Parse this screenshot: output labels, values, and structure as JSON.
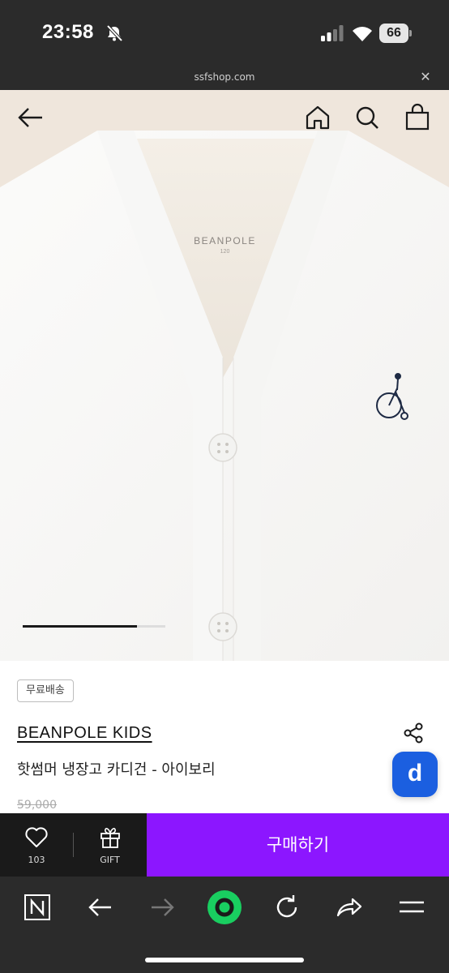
{
  "status_bar": {
    "time": "23:58",
    "battery": "66"
  },
  "url_bar": {
    "domain": "ssfshop.com",
    "close_icon": "close-icon"
  },
  "image_nav": {
    "back_icon": "arrow-left-icon",
    "home_icon": "home-icon",
    "search_icon": "search-icon",
    "cart_icon": "shopping-bag-icon"
  },
  "product_photo": {
    "tag_brand": "BEANPOLE",
    "tag_size": "120"
  },
  "carousel": {
    "progress": 0.8
  },
  "product": {
    "badge": "무료배송",
    "brand": "BEANPOLE KIDS",
    "name": "핫썸머 냉장고 카디건 - 아이보리",
    "price": "59,000",
    "floating_button_label": "d"
  },
  "purchase_bar": {
    "like_count": "103",
    "gift_label": "GIFT",
    "buy_label": "구매하기"
  },
  "colors": {
    "buy_button": "#8c16ff",
    "floating_button": "#1b5fe0",
    "chrome_background": "#2b2b2b"
  },
  "browser_toolbar": {
    "items": [
      "naver-icon",
      "back-arrow-icon",
      "forward-arrow-icon",
      "green-dot-icon",
      "reload-icon",
      "share-icon",
      "menu-icon"
    ]
  }
}
